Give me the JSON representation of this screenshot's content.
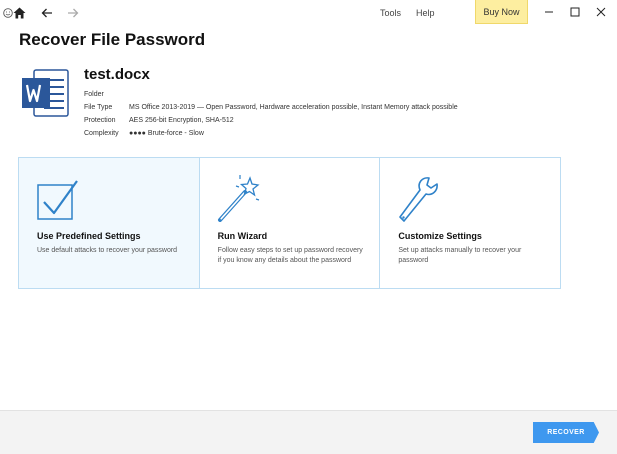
{
  "titlebar": {
    "menu": {
      "tools": "Tools",
      "help": "Help"
    },
    "buy_now": "Buy Now",
    "icons": [
      "home-icon",
      "back-arrow-icon",
      "forward-arrow-icon",
      "smiley-icon",
      "minimize-icon",
      "maximize-icon",
      "close-icon"
    ]
  },
  "page": {
    "title": "Recover File Password"
  },
  "file": {
    "name": "test.docx",
    "folder_label": "Folder",
    "rows": [
      {
        "key": "File Type",
        "value": "MS Office 2013-2019 — Open Password, Hardware acceleration possible, Instant Memory attack possible"
      },
      {
        "key": "Protection",
        "value": "AES 256-bit Encryption, SHA-512"
      },
      {
        "key": "Complexity",
        "value": "●●●● Brute-force - Slow"
      }
    ]
  },
  "options": [
    {
      "title": "Use Predefined Settings",
      "desc": "Use default attacks to recover your password",
      "selected": true
    },
    {
      "title": "Run Wizard",
      "desc": "Follow easy steps to set up password recovery if you know any details about the password",
      "selected": false
    },
    {
      "title": "Customize Settings",
      "desc": "Set up attacks manually to recover your password",
      "selected": false
    }
  ],
  "footer": {
    "recover_label": "RECOVER"
  },
  "colors": {
    "accent": "#3e98ef",
    "card_border": "#bcdcf2",
    "buy_bg": "#fdeea0",
    "word_blue": "#2b579a"
  }
}
